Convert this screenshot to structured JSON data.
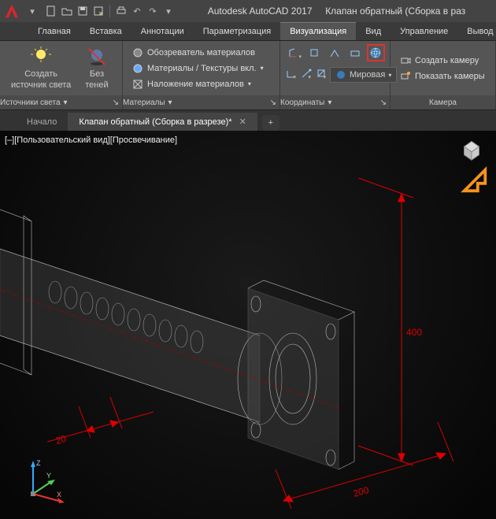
{
  "title": {
    "app": "Autodesk AutoCAD 2017",
    "file": "Клапан обратный (Сборка в раз"
  },
  "qat": {
    "logo": "A",
    "buttons": [
      "new",
      "open",
      "save",
      "saveas",
      "plot",
      "undo",
      "redo"
    ]
  },
  "ribbon": {
    "tabs": [
      "Главная",
      "Вставка",
      "Аннотации",
      "Параметризация",
      "Визуализация",
      "Вид",
      "Управление",
      "Вывод"
    ],
    "active_tab": "Визуализация",
    "panels": {
      "lights": {
        "label": "Источники света",
        "create_label": "Создать\nисточник света",
        "noshadow_label": "Без\nтеней"
      },
      "materials": {
        "label": "Материалы",
        "browser": "Обозреватель материалов",
        "textures": "Материалы / Текстуры вкл.",
        "overlay": "Наложение материалов"
      },
      "coords": {
        "label": "Координаты",
        "world_label": "Мировая"
      },
      "camera": {
        "label": "Камера",
        "create": "Создать камеру",
        "show": "Показать камеры"
      }
    }
  },
  "doc_tabs": {
    "home": "Начало",
    "active": "Клапан обратный (Сборка в разрезе)*",
    "add": "+"
  },
  "viewport": {
    "bracket_left": "[–]",
    "view_style": "[Пользовательский вид]",
    "visual_style": "[Просвечивание]",
    "dimensions": {
      "d400": "400",
      "d200": "200",
      "d20": "20"
    },
    "axes": {
      "x": "X",
      "y": "Y",
      "z": "Z"
    }
  }
}
